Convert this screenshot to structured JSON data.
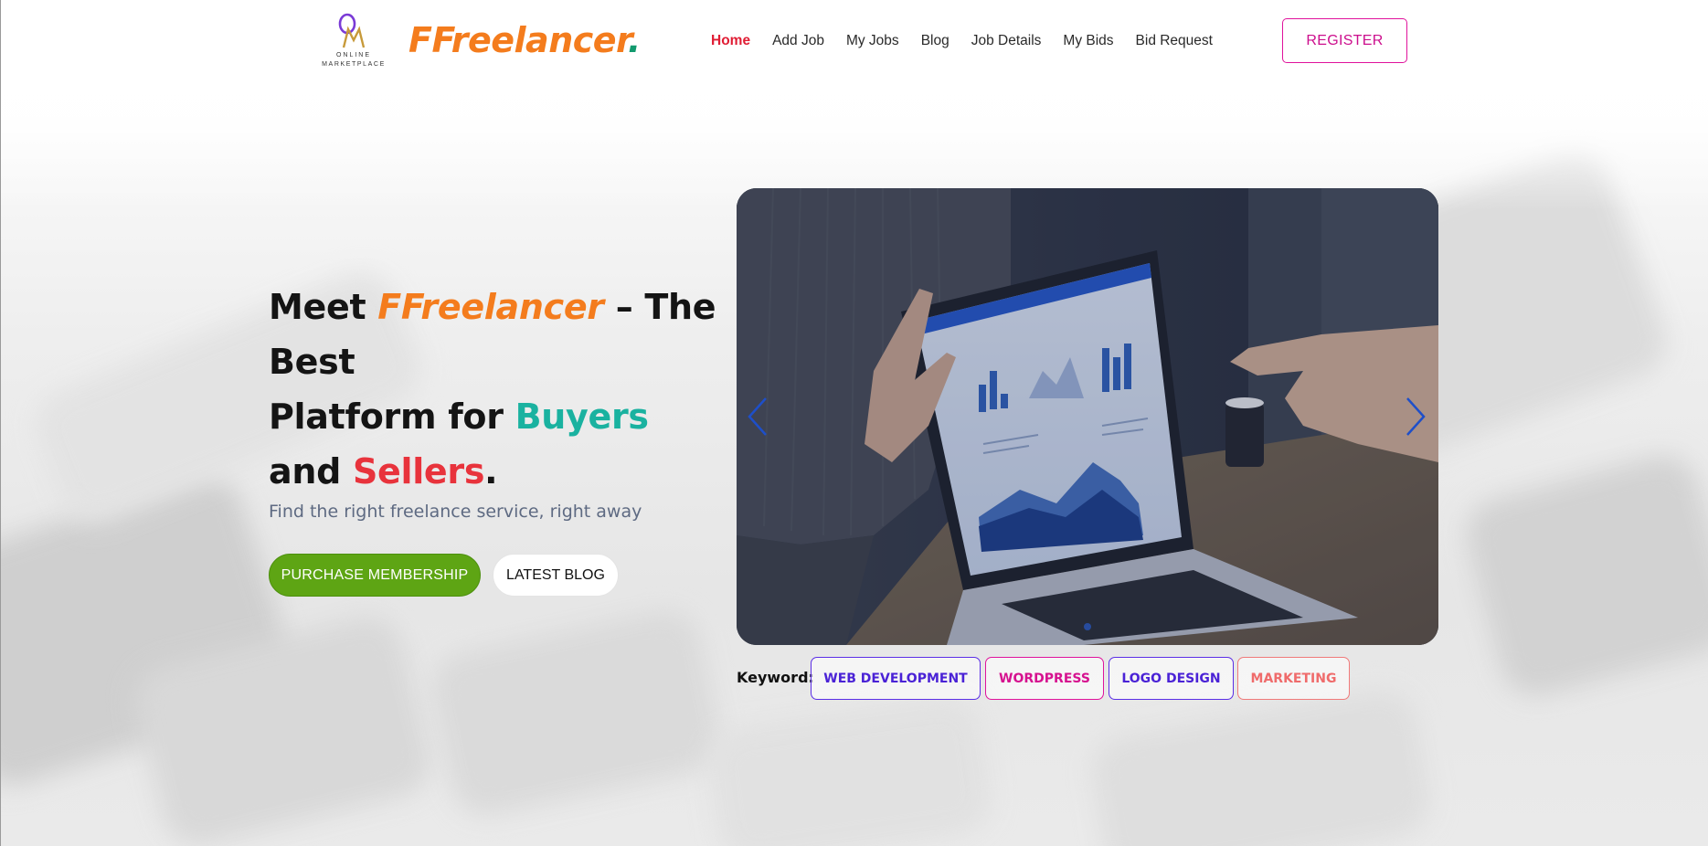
{
  "header": {
    "logo": {
      "mark": "OM",
      "line1": "ONLINE",
      "line2": "MARKETPLACE"
    },
    "brand": {
      "name": "FFreelancer",
      "dot": ".",
      "color": "#f47c1d",
      "dot_color": "#129a6e"
    },
    "nav": [
      {
        "label": "Home",
        "active": true
      },
      {
        "label": "Add Job"
      },
      {
        "label": "My Jobs"
      },
      {
        "label": "Blog"
      },
      {
        "label": "Job Details"
      },
      {
        "label": "My Bids"
      },
      {
        "label": "Bid Request"
      }
    ],
    "register_label": "REGISTER"
  },
  "hero": {
    "title": {
      "meet": "Meet ",
      "brand": "FFreelancer",
      "the_best": " – The Best",
      "platform_for": "Platform for ",
      "buyers": "Buyers",
      "and": "and ",
      "sellers": "Sellers",
      "period": "."
    },
    "subtitle": "Find the right freelance service, right away",
    "buttons": {
      "purchase": "PURCHASE MEMBERSHIP",
      "blog": "LATEST BLOG"
    },
    "colors": {
      "brand": "#f47c1d",
      "buyers": "#1ab2a0",
      "sellers": "#e8333c",
      "purchase_bg": "#5ea514"
    }
  },
  "slider": {
    "prev_icon": "chevron-left-icon",
    "next_icon": "chevron-right-icon",
    "slide_image": "laptop-analytics-meeting",
    "dot_count": 1
  },
  "keywords": {
    "label": "Keyword:",
    "items": [
      "WEB DEVELOPMENT",
      "WORDPRESS",
      "LOGO DESIGN",
      "MARKETING"
    ]
  }
}
